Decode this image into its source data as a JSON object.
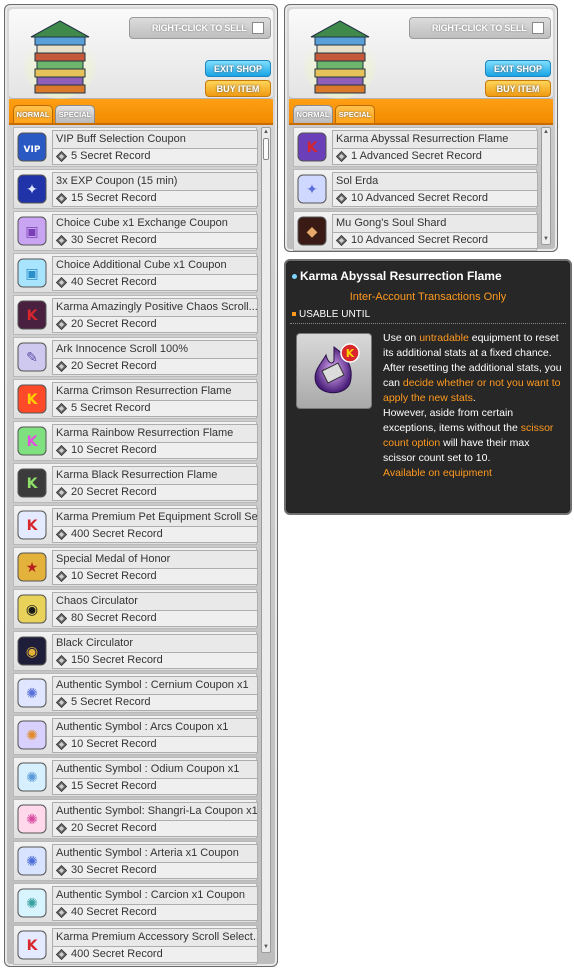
{
  "shop": {
    "sell_label": "RIGHT-CLICK TO SELL",
    "exit_label": "EXIT SHOP",
    "buy_label": "BUY ITEM",
    "colors": {
      "tab_orange": "#f28a00",
      "exit_blue": "#1aa4e4",
      "buy_orange": "#f09a12"
    }
  },
  "left": {
    "tabs": [
      {
        "label": "NORMAL",
        "active": true
      },
      {
        "label": "SPECIAL",
        "active": false
      }
    ],
    "items": [
      {
        "name": "VIP Buff Selection Coupon",
        "price": "5 Secret Record",
        "icon": "vip-coupon-icon"
      },
      {
        "name": "3x EXP Coupon (15 min)",
        "price": "15 Secret Record",
        "icon": "exp-coupon-icon"
      },
      {
        "name": "Choice Cube x1 Exchange Coupon",
        "price": "30 Secret Record",
        "icon": "purple-cube-icon"
      },
      {
        "name": "Choice Additional Cube x1 Coupon",
        "price": "40 Secret Record",
        "icon": "blue-cube-icon"
      },
      {
        "name": "Karma Amazingly Positive Chaos Scroll...",
        "price": "20 Secret Record",
        "icon": "karma-scroll-icon"
      },
      {
        "name": "Ark Innocence Scroll 100%",
        "price": "20 Secret Record",
        "icon": "scroll-icon"
      },
      {
        "name": "Karma Crimson Resurrection Flame",
        "price": "5 Secret Record",
        "icon": "red-flame-icon"
      },
      {
        "name": "Karma Rainbow Resurrection Flame",
        "price": "10 Secret Record",
        "icon": "rainbow-flame-icon"
      },
      {
        "name": "Karma Black Resurrection Flame",
        "price": "20 Secret Record",
        "icon": "black-flame-icon"
      },
      {
        "name": "Karma Premium Pet Equipment Scroll Sel...",
        "price": "400 Secret Record",
        "icon": "pet-scroll-box-icon"
      },
      {
        "name": "Special Medal of Honor",
        "price": "10 Secret Record",
        "icon": "medal-icon"
      },
      {
        "name": "Chaos Circulator",
        "price": "80 Secret Record",
        "icon": "chaos-circulator-icon"
      },
      {
        "name": "Black Circulator",
        "price": "150 Secret Record",
        "icon": "black-circulator-icon"
      },
      {
        "name": "Authentic Symbol : Cernium Coupon x1",
        "price": "5 Secret Record",
        "icon": "symbol-cernium-icon"
      },
      {
        "name": "Authentic Symbol : Arcs Coupon x1",
        "price": "10 Secret Record",
        "icon": "symbol-arcs-icon"
      },
      {
        "name": "Authentic Symbol : Odium Coupon x1",
        "price": "15 Secret Record",
        "icon": "symbol-odium-icon"
      },
      {
        "name": "Authentic Symbol: Shangri-La Coupon x1",
        "price": "20 Secret Record",
        "icon": "symbol-shangrila-icon"
      },
      {
        "name": "Authentic Symbol : Arteria x1 Coupon",
        "price": "30 Secret Record",
        "icon": "symbol-arteria-icon"
      },
      {
        "name": "Authentic Symbol : Carcion x1 Coupon",
        "price": "40 Secret Record",
        "icon": "symbol-carcion-icon"
      },
      {
        "name": "Karma Premium Accessory Scroll Select...",
        "price": "400 Secret Record",
        "icon": "accessory-scroll-box-icon"
      }
    ]
  },
  "right": {
    "tabs": [
      {
        "label": "NORMAL",
        "active": false
      },
      {
        "label": "SPECIAL",
        "active": true
      }
    ],
    "items": [
      {
        "name": "Karma Abyssal Resurrection Flame",
        "price": "1 Advanced Secret Record",
        "icon": "abyssal-flame-icon"
      },
      {
        "name": "Sol Erda",
        "price": "10 Advanced Secret Record",
        "icon": "sol-erda-icon"
      },
      {
        "name": "Mu Gong's Soul Shard",
        "price": "10 Advanced Secret Record",
        "icon": "soul-shard-icon"
      }
    ]
  },
  "tooltip": {
    "title": "Karma Abyssal Resurrection Flame",
    "subtitle": "Inter-Account Transactions Only",
    "usable": "USABLE UNTIL",
    "desc": {
      "p1": "Use on ",
      "h1": "untradable",
      "p2": " equipment to reset its additional stats at a fixed chance. After resetting the additional stats, you can ",
      "h2": "decide whether or not you want to apply the new stats",
      "p3": ".",
      "p4": "However, aside from certain exceptions, items without the ",
      "h3": "scissor count option",
      "p5": " will have their max scissor count set to 10.",
      "h4": "Available on equipment"
    }
  }
}
